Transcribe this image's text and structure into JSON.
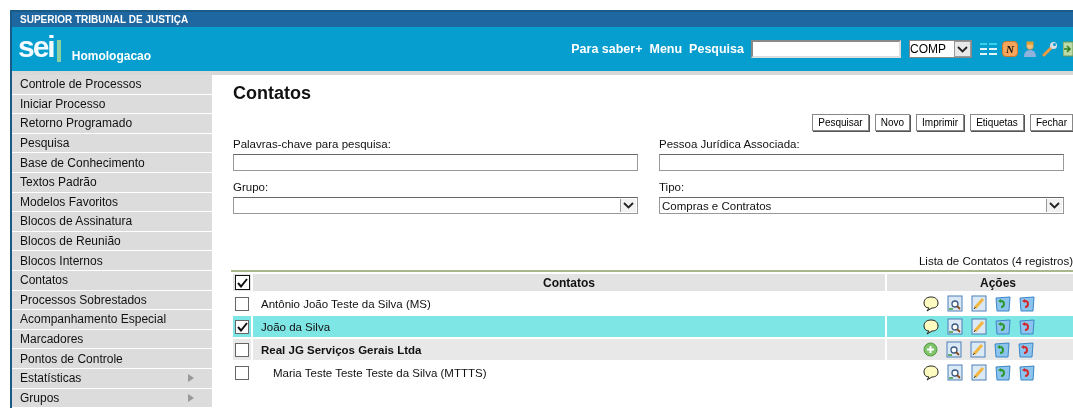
{
  "header": {
    "organization": "SUPERIOR TRIBUNAL DE JUSTIÇA",
    "logo": "sei",
    "environment": "Homologacao",
    "links": [
      "Para saber+",
      "Menu",
      "Pesquisa"
    ],
    "unit_select": {
      "value": "COMP"
    },
    "notice_badge": "N"
  },
  "sidebar": {
    "items": [
      {
        "label": "Controle de Processos",
        "kind": "link"
      },
      {
        "label": "Iniciar Processo",
        "kind": "link"
      },
      {
        "label": "Retorno Programado",
        "kind": "link"
      },
      {
        "label": "Pesquisa",
        "kind": "link"
      },
      {
        "label": "Base de Conhecimento",
        "kind": "link"
      },
      {
        "label": "Textos Padrão",
        "kind": "link"
      },
      {
        "label": "Modelos Favoritos",
        "kind": "link"
      },
      {
        "label": "Blocos de Assinatura",
        "kind": "link"
      },
      {
        "label": "Blocos de Reunião",
        "kind": "link"
      },
      {
        "label": "Blocos Internos",
        "kind": "link"
      },
      {
        "label": "Contatos",
        "kind": "link"
      },
      {
        "label": "Processos Sobrestados",
        "kind": "link"
      },
      {
        "label": "Acompanhamento Especial",
        "kind": "link"
      },
      {
        "label": "Marcadores",
        "kind": "link"
      },
      {
        "label": "Pontos de Controle",
        "kind": "link"
      },
      {
        "label": "Estatísticas",
        "kind": "submenu"
      },
      {
        "label": "Grupos",
        "kind": "submenu"
      }
    ]
  },
  "page": {
    "title": "Contatos",
    "buttons": [
      "Pesquisar",
      "Novo",
      "Imprimir",
      "Etiquetas",
      "Fechar"
    ],
    "fields": [
      {
        "label": "Palavras-chave para pesquisa:",
        "kind": "text"
      },
      {
        "label": "Pessoa Jurídica Associada:",
        "kind": "text"
      },
      {
        "label": "Grupo:",
        "kind": "select"
      },
      {
        "label": "Tipo:",
        "kind": "select",
        "value": "Compras e Contratos"
      }
    ],
    "table": {
      "caption": "Lista de Contatos (4 registros)",
      "header_checked": true,
      "columns": [
        "Contatos",
        "Ações"
      ],
      "rows": [
        {
          "name": "Antônio João Teste da Silva (MS)",
          "kind": "person",
          "selected": false
        },
        {
          "name": "João da Silva",
          "kind": "person",
          "selected": true
        },
        {
          "name": "Real JG Serviços Gerais Ltda",
          "kind": "company",
          "selected": false,
          "children": [
            {
              "name": "Maria Teste Teste Teste da Silva (MTTTS)",
              "kind": "person",
              "selected": false
            }
          ]
        }
      ]
    }
  }
}
